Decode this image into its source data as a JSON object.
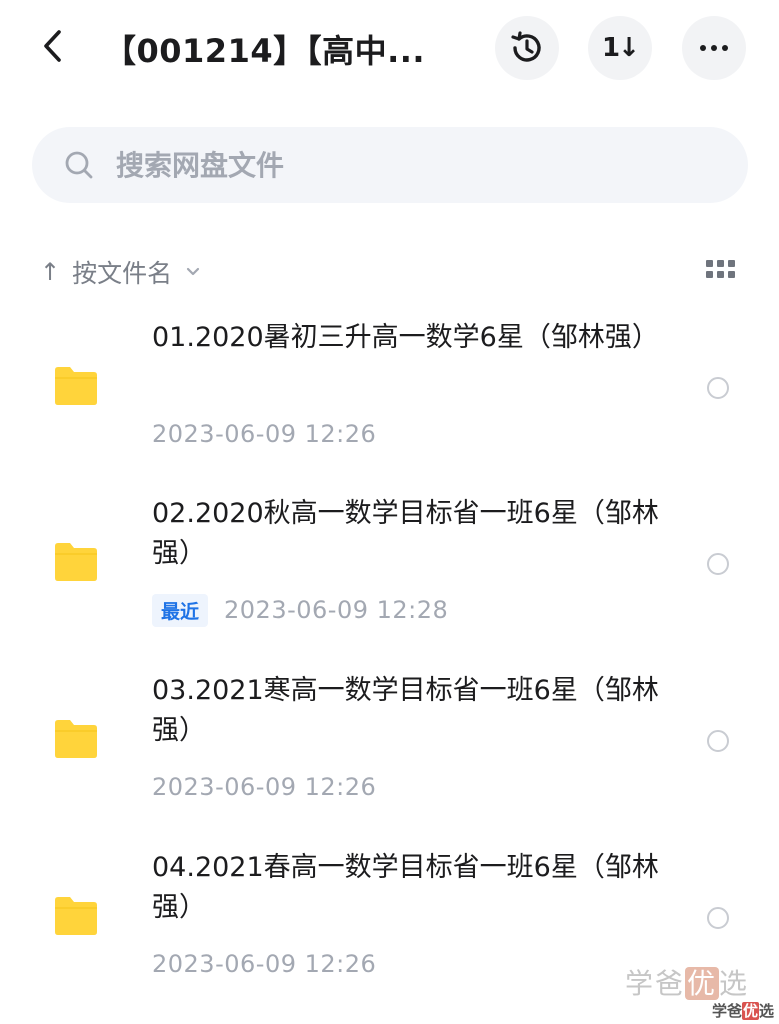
{
  "header": {
    "title": "【001214】【高中...",
    "back_icon": "chevron-left-icon",
    "history_icon": "history-icon",
    "sort_glyph": "1↓",
    "more_icon": "more-horizontal-icon"
  },
  "search": {
    "placeholder": "搜索网盘文件",
    "value": ""
  },
  "sort": {
    "arrow": "↑",
    "label": "按文件名"
  },
  "files": [
    {
      "name": "01.2020暑初三升高一数学6星（邹林强）",
      "badge": "",
      "date": "2023-06-09  12:26"
    },
    {
      "name": "02.2020秋高一数学目标省一班6星（邹林强）",
      "badge": "最近",
      "date": "2023-06-09  12:28"
    },
    {
      "name": "03.2021寒高一数学目标省一班6星（邹林强）",
      "badge": "",
      "date": "2023-06-09  12:26"
    },
    {
      "name": "04.2021春高一数学目标省一班6星（邹林强）",
      "badge": "",
      "date": "2023-06-09  12:26"
    }
  ],
  "watermark": {
    "a": "学爸",
    "b": "优",
    "c": "选"
  },
  "colors": {
    "folder": "#ffd43b",
    "accent": "#1f73e6",
    "muted": "#a3a8b2"
  }
}
